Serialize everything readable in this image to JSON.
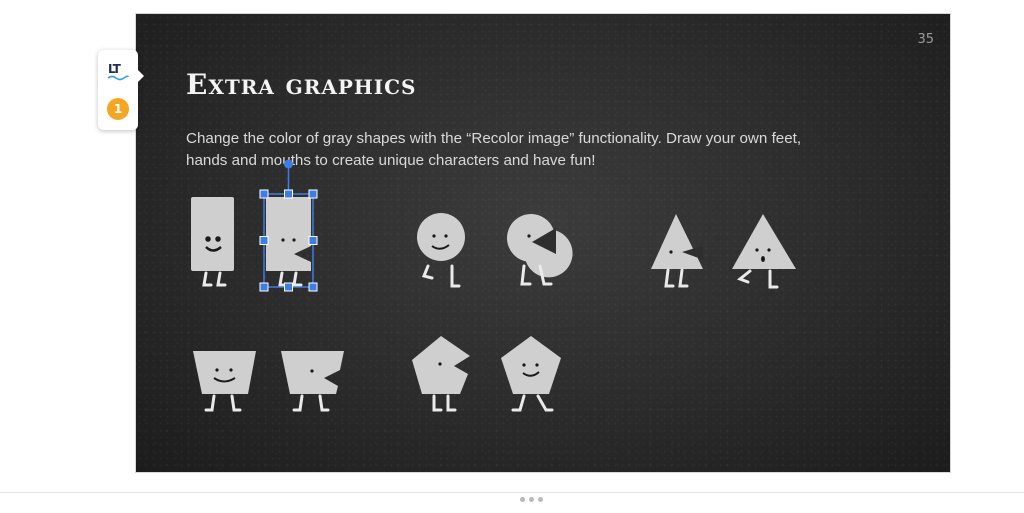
{
  "slide": {
    "number": "35",
    "title": "Extra graphics",
    "body": "Change the color of gray shapes with the “Recolor image” functionality. Draw your own feet, hands and mouths to create unique characters and have fun!"
  },
  "addon": {
    "logo_text": "LT",
    "badge_count": "1"
  },
  "colors": {
    "slide_background": "#2b2b2b",
    "shape_fill": "#cfcfcf",
    "selection": "#1a73e8",
    "badge": "#f5a623"
  },
  "icons": {
    "addon_logo": "languagetool-logo-icon",
    "resize_handle": "more-dots-icon"
  }
}
